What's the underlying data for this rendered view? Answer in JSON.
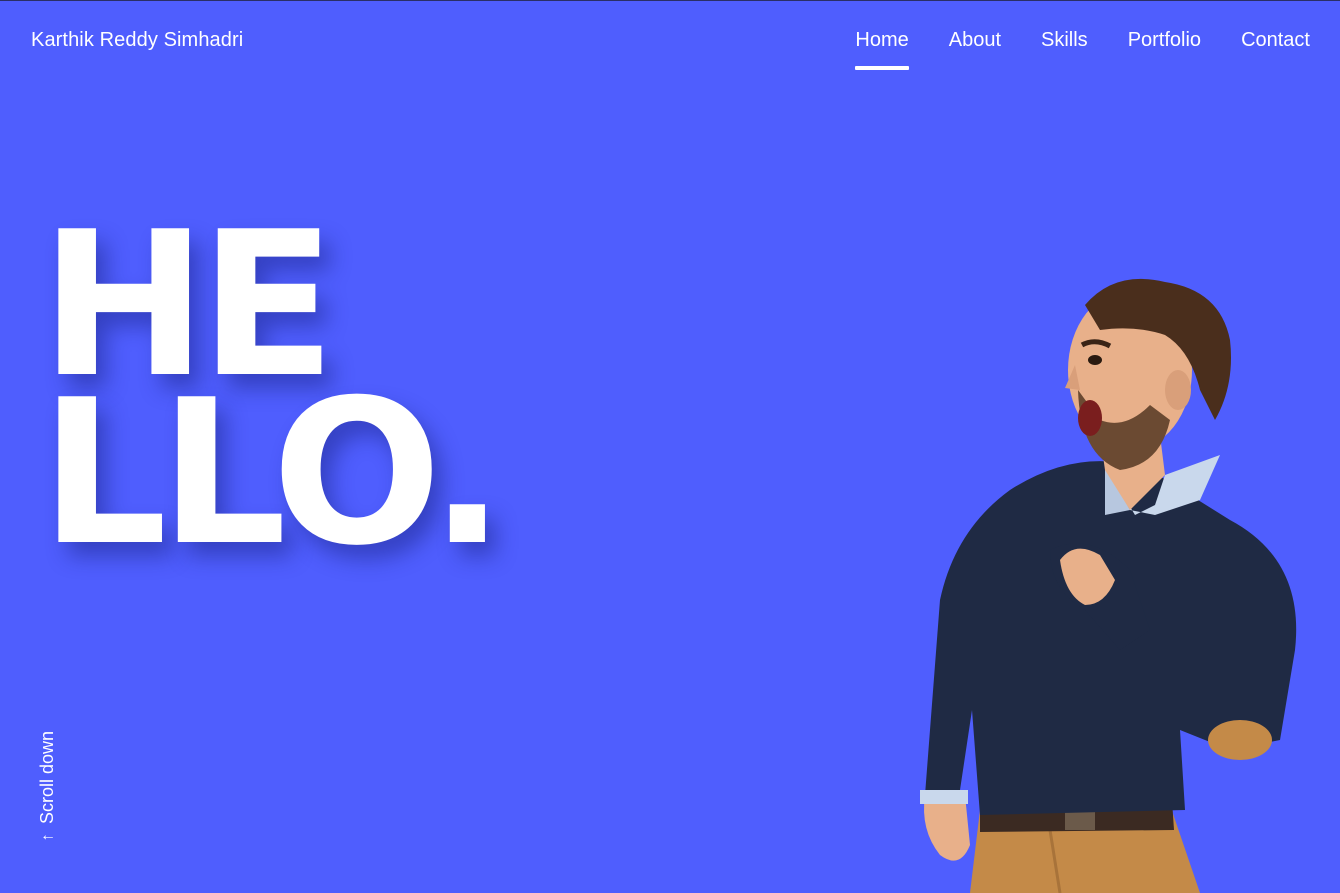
{
  "header": {
    "brand": "Karthik Reddy Simhadri",
    "nav": [
      {
        "label": "Home",
        "active": true
      },
      {
        "label": "About",
        "active": false
      },
      {
        "label": "Skills",
        "active": false
      },
      {
        "label": "Portfolio",
        "active": false
      },
      {
        "label": "Contact",
        "active": false
      }
    ]
  },
  "hero": {
    "line1": "HE",
    "line2": "LLO."
  },
  "scroll": {
    "arrow_icon": "arrow-down-icon",
    "label": "Scroll down"
  },
  "colors": {
    "background": "#4f5efe",
    "text": "#ffffff",
    "sweater": "#1f2a44",
    "pants": "#c48a48"
  }
}
